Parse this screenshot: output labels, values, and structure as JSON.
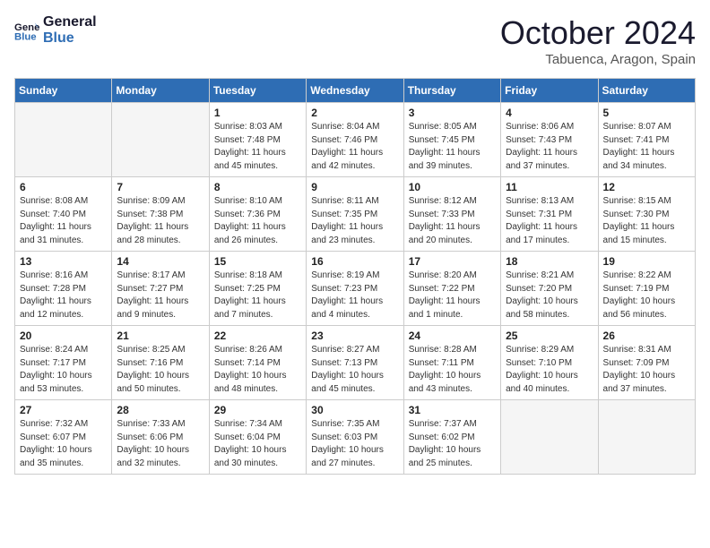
{
  "header": {
    "logo_line1": "General",
    "logo_line2": "Blue",
    "month": "October 2024",
    "location": "Tabuenca, Aragon, Spain"
  },
  "weekdays": [
    "Sunday",
    "Monday",
    "Tuesday",
    "Wednesday",
    "Thursday",
    "Friday",
    "Saturday"
  ],
  "weeks": [
    [
      {
        "day": "",
        "info": ""
      },
      {
        "day": "",
        "info": ""
      },
      {
        "day": "1",
        "info": "Sunrise: 8:03 AM\nSunset: 7:48 PM\nDaylight: 11 hours and 45 minutes."
      },
      {
        "day": "2",
        "info": "Sunrise: 8:04 AM\nSunset: 7:46 PM\nDaylight: 11 hours and 42 minutes."
      },
      {
        "day": "3",
        "info": "Sunrise: 8:05 AM\nSunset: 7:45 PM\nDaylight: 11 hours and 39 minutes."
      },
      {
        "day": "4",
        "info": "Sunrise: 8:06 AM\nSunset: 7:43 PM\nDaylight: 11 hours and 37 minutes."
      },
      {
        "day": "5",
        "info": "Sunrise: 8:07 AM\nSunset: 7:41 PM\nDaylight: 11 hours and 34 minutes."
      }
    ],
    [
      {
        "day": "6",
        "info": "Sunrise: 8:08 AM\nSunset: 7:40 PM\nDaylight: 11 hours and 31 minutes."
      },
      {
        "day": "7",
        "info": "Sunrise: 8:09 AM\nSunset: 7:38 PM\nDaylight: 11 hours and 28 minutes."
      },
      {
        "day": "8",
        "info": "Sunrise: 8:10 AM\nSunset: 7:36 PM\nDaylight: 11 hours and 26 minutes."
      },
      {
        "day": "9",
        "info": "Sunrise: 8:11 AM\nSunset: 7:35 PM\nDaylight: 11 hours and 23 minutes."
      },
      {
        "day": "10",
        "info": "Sunrise: 8:12 AM\nSunset: 7:33 PM\nDaylight: 11 hours and 20 minutes."
      },
      {
        "day": "11",
        "info": "Sunrise: 8:13 AM\nSunset: 7:31 PM\nDaylight: 11 hours and 17 minutes."
      },
      {
        "day": "12",
        "info": "Sunrise: 8:15 AM\nSunset: 7:30 PM\nDaylight: 11 hours and 15 minutes."
      }
    ],
    [
      {
        "day": "13",
        "info": "Sunrise: 8:16 AM\nSunset: 7:28 PM\nDaylight: 11 hours and 12 minutes."
      },
      {
        "day": "14",
        "info": "Sunrise: 8:17 AM\nSunset: 7:27 PM\nDaylight: 11 hours and 9 minutes."
      },
      {
        "day": "15",
        "info": "Sunrise: 8:18 AM\nSunset: 7:25 PM\nDaylight: 11 hours and 7 minutes."
      },
      {
        "day": "16",
        "info": "Sunrise: 8:19 AM\nSunset: 7:23 PM\nDaylight: 11 hours and 4 minutes."
      },
      {
        "day": "17",
        "info": "Sunrise: 8:20 AM\nSunset: 7:22 PM\nDaylight: 11 hours and 1 minute."
      },
      {
        "day": "18",
        "info": "Sunrise: 8:21 AM\nSunset: 7:20 PM\nDaylight: 10 hours and 58 minutes."
      },
      {
        "day": "19",
        "info": "Sunrise: 8:22 AM\nSunset: 7:19 PM\nDaylight: 10 hours and 56 minutes."
      }
    ],
    [
      {
        "day": "20",
        "info": "Sunrise: 8:24 AM\nSunset: 7:17 PM\nDaylight: 10 hours and 53 minutes."
      },
      {
        "day": "21",
        "info": "Sunrise: 8:25 AM\nSunset: 7:16 PM\nDaylight: 10 hours and 50 minutes."
      },
      {
        "day": "22",
        "info": "Sunrise: 8:26 AM\nSunset: 7:14 PM\nDaylight: 10 hours and 48 minutes."
      },
      {
        "day": "23",
        "info": "Sunrise: 8:27 AM\nSunset: 7:13 PM\nDaylight: 10 hours and 45 minutes."
      },
      {
        "day": "24",
        "info": "Sunrise: 8:28 AM\nSunset: 7:11 PM\nDaylight: 10 hours and 43 minutes."
      },
      {
        "day": "25",
        "info": "Sunrise: 8:29 AM\nSunset: 7:10 PM\nDaylight: 10 hours and 40 minutes."
      },
      {
        "day": "26",
        "info": "Sunrise: 8:31 AM\nSunset: 7:09 PM\nDaylight: 10 hours and 37 minutes."
      }
    ],
    [
      {
        "day": "27",
        "info": "Sunrise: 7:32 AM\nSunset: 6:07 PM\nDaylight: 10 hours and 35 minutes."
      },
      {
        "day": "28",
        "info": "Sunrise: 7:33 AM\nSunset: 6:06 PM\nDaylight: 10 hours and 32 minutes."
      },
      {
        "day": "29",
        "info": "Sunrise: 7:34 AM\nSunset: 6:04 PM\nDaylight: 10 hours and 30 minutes."
      },
      {
        "day": "30",
        "info": "Sunrise: 7:35 AM\nSunset: 6:03 PM\nDaylight: 10 hours and 27 minutes."
      },
      {
        "day": "31",
        "info": "Sunrise: 7:37 AM\nSunset: 6:02 PM\nDaylight: 10 hours and 25 minutes."
      },
      {
        "day": "",
        "info": ""
      },
      {
        "day": "",
        "info": ""
      }
    ]
  ]
}
